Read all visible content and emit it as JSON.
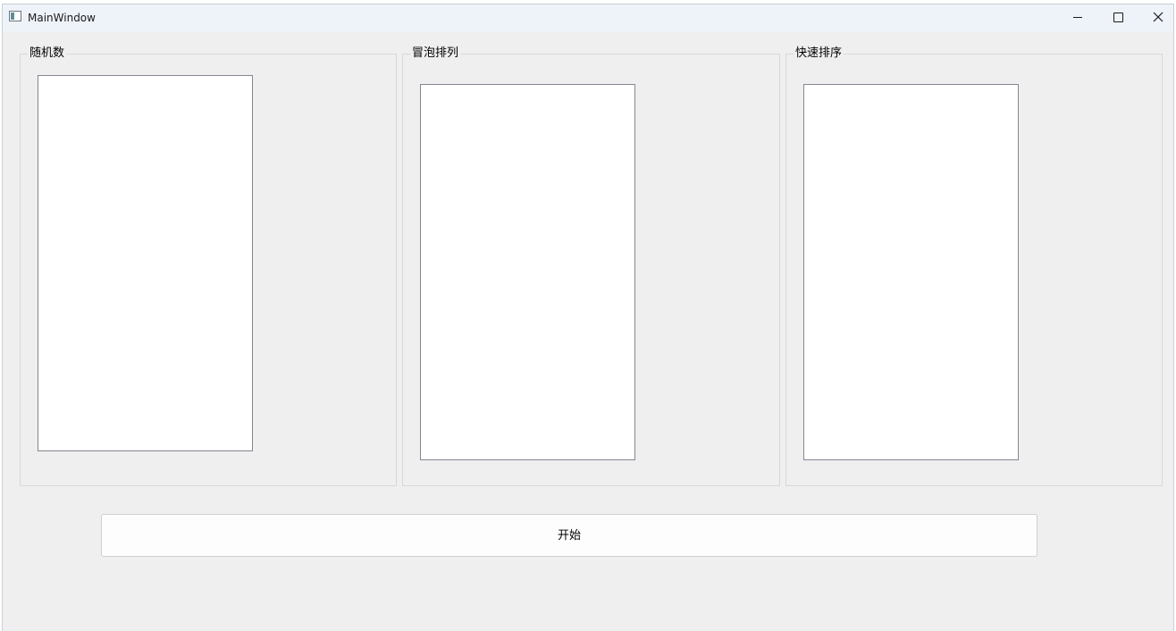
{
  "window": {
    "title": "MainWindow"
  },
  "groups": [
    {
      "title": "随机数"
    },
    {
      "title": "冒泡排列"
    },
    {
      "title": "快速排序"
    }
  ],
  "actions": {
    "start_label": "开始"
  },
  "icons": {
    "app": "window-app-icon",
    "minimize": "minimize-icon",
    "maximize": "maximize-icon",
    "close": "close-icon"
  }
}
